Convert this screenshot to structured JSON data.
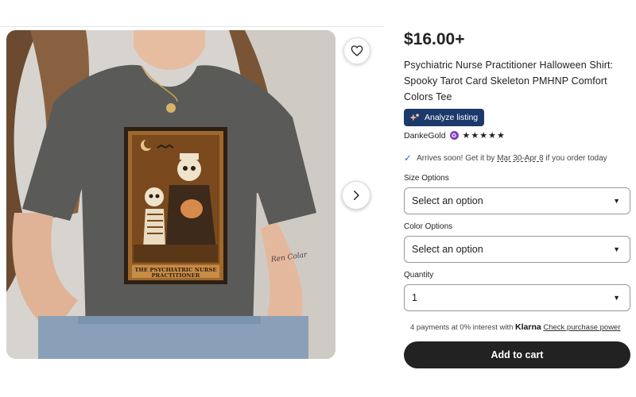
{
  "product": {
    "price": "$16.00+",
    "title": "Psychiatric Nurse Practitioner Halloween Shirt: Spooky Tarot Card Skeleton PMHNP Comfort Colors Tee",
    "analyze_label": "Analyze listing",
    "shop_name": "DankeGold",
    "rating_stars": "★★★★★",
    "card_text_line1": "THE PSYCHIATRIC NURSE",
    "card_text_line2": "PRACTITIONER",
    "tattoo_text": "Ren Colar"
  },
  "shipping": {
    "prefix": "Arrives soon! Get it by",
    "dates": "Mar 30-Apr 8",
    "suffix": "if you order today"
  },
  "options": {
    "size_label": "Size Options",
    "size_value": "Select an option",
    "color_label": "Color Options",
    "color_value": "Select an option",
    "quantity_label": "Quantity",
    "quantity_value": "1"
  },
  "payment": {
    "text": "4 payments at 0% interest with",
    "brand": "Klarna",
    "link": "Check purchase power"
  },
  "cart": {
    "add_label": "Add to cart"
  },
  "icons": {
    "favorite": "heart-icon",
    "next": "chevron-right-icon",
    "analyze": "sparkle-icon",
    "arrival": "check-icon",
    "dropdown": "caret-down-icon"
  },
  "colors": {
    "shirt": "#5a5a58",
    "analyze_bg": "#1b3a6b",
    "cart_bg": "#222222",
    "star_seller": "#7f3fbf",
    "card_brown": "#a0682c"
  }
}
